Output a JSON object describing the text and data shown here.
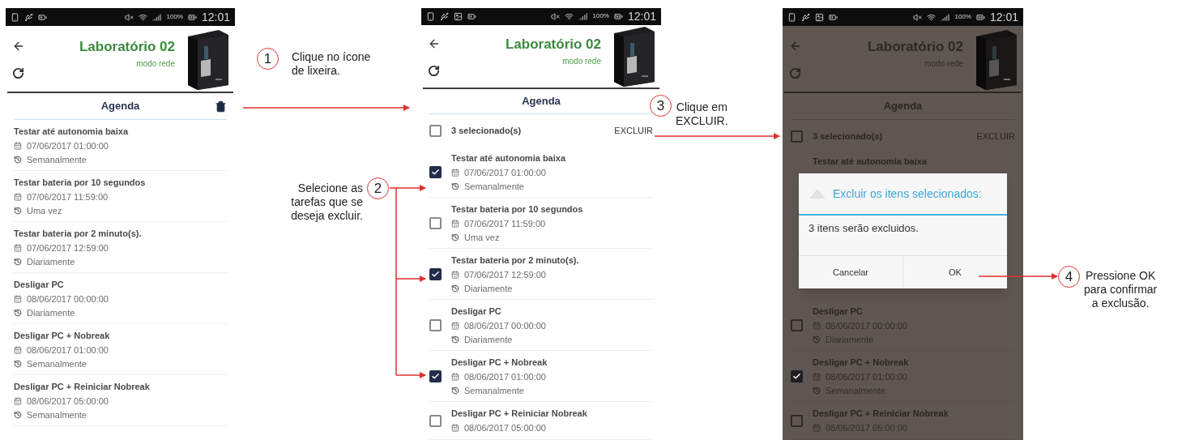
{
  "screens": [
    {
      "dimmed": false,
      "status_bar": {
        "battery": "100%",
        "time": "12:01"
      },
      "header": {
        "title": "Laboratório 02",
        "subtitle": "modo rede"
      },
      "section": {
        "title": "Agenda"
      },
      "items": [
        {
          "title": "Testar até autonomia baixa",
          "date": "07/06/2017 01:00:00",
          "repeat": "Semanalmente"
        },
        {
          "title": "Testar bateria por 10 segundos",
          "date": "07/06/2017 11:59:00",
          "repeat": "Uma vez"
        },
        {
          "title": "Testar bateria por 2 minuto(s).",
          "date": "07/06/2017 12:59:00",
          "repeat": "Diariamente"
        },
        {
          "title": "Desligar PC",
          "date": "08/06/2017 00:00:00",
          "repeat": "Diariamente"
        },
        {
          "title": "Desligar PC + Nobreak",
          "date": "08/06/2017 01:00:00",
          "repeat": "Semanalmente"
        },
        {
          "title": "Desligar PC + Reiniciar Nobreak",
          "date": "08/06/2017 05:00:00",
          "repeat": "Semanalmente"
        }
      ]
    },
    {
      "dimmed": false,
      "status_bar": {
        "battery": "100%",
        "time": "12:01"
      },
      "header": {
        "title": "Laboratório 02",
        "subtitle": "modo rede"
      },
      "section": {
        "title": "Agenda"
      },
      "selection_bar": {
        "checked": false,
        "count": "3 selecionado(s)",
        "action": "EXCLUIR"
      },
      "items": [
        {
          "title": "Testar até autonomia baixa",
          "date": "07/06/2017 01:00:00",
          "repeat": "Semanalmente",
          "checked": true
        },
        {
          "title": "Testar bateria por 10 segundos",
          "date": "07/06/2017 11:59:00",
          "repeat": "Uma vez",
          "checked": false
        },
        {
          "title": "Testar bateria por 2 minuto(s).",
          "date": "07/06/2017 12:59:00",
          "repeat": "Diariamente",
          "checked": true
        },
        {
          "title": "Desligar PC",
          "date": "08/06/2017 00:00:00",
          "repeat": "Diariamente",
          "checked": false
        },
        {
          "title": "Desligar PC + Nobreak",
          "date": "08/06/2017 01:00:00",
          "repeat": "Semanalmente",
          "checked": true
        },
        {
          "title": "Desligar PC + Reiniciar Nobreak",
          "date": "08/06/2017 05:00:00",
          "checked": false
        }
      ]
    },
    {
      "dimmed": true,
      "status_bar": {
        "battery": "100%",
        "time": "12:01"
      },
      "header": {
        "title": "Laboratório 02",
        "subtitle": "modo rede"
      },
      "section": {
        "title": "Agenda"
      },
      "selection_bar": {
        "checked": false,
        "count": "3 selecionado(s)",
        "action": "EXCLUIR"
      },
      "items": [
        {
          "title": "Testar até autonomia baixa"
        }
      ],
      "dialog": {
        "title": "Excluir os itens selecionados:",
        "message": "3 itens serão excluidos.",
        "buttons": [
          "Cancelar",
          "OK"
        ]
      },
      "items_after": [
        {
          "title": "Desligar PC",
          "date": "08/06/2017 00:00:00",
          "repeat": "Diariamente",
          "checked": false
        },
        {
          "title": "Desligar PC + Nobreak",
          "date": "08/06/2017 01:00:00",
          "repeat": "Semanalmente",
          "checked": true
        },
        {
          "title": "Desligar PC + Reiniciar Nobreak",
          "date": "08/06/2017 05:00:00",
          "checked": false
        }
      ]
    }
  ],
  "annotations": [
    {
      "number": "1",
      "text": "Clique no ícone\nde lixeira."
    },
    {
      "number": "2",
      "text": "Selecione as\ntarefas que se\ndeseja excluir."
    },
    {
      "number": "3",
      "text": "Clique em\nEXCLUIR."
    },
    {
      "number": "4",
      "text": "Pressione OK\npara confirmar\na exclusão."
    }
  ]
}
